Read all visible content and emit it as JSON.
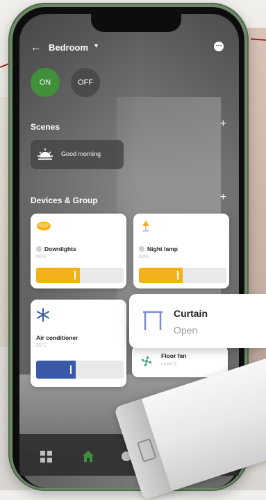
{
  "colors": {
    "accent_green": "#3f8f3b",
    "slider_yellow": "#f2b21a",
    "slider_blue": "#3a58a8",
    "card_bg": "#ffffff",
    "curtain_icon": "#7a8ccf",
    "fan_icon": "#4aa58a"
  },
  "header": {
    "room": "Bedroom",
    "back_icon": "arrow-left-icon",
    "more_icon": "more-icon"
  },
  "power": {
    "on_label": "ON",
    "off_label": "OFF"
  },
  "scenes": {
    "title": "Scenes",
    "items": [
      {
        "label": "Good morning",
        "icon": "sunrise-icon"
      }
    ]
  },
  "devices": {
    "title": "Devices & Group",
    "downlights": {
      "name": "Downlights",
      "level_text": "50%",
      "level": 0.5
    },
    "night_lamp": {
      "name": "Night lamp",
      "level_text": "50%",
      "level": 0.5
    },
    "air_conditioner": {
      "name": "Air conditioner",
      "temp": "25°C",
      "level": 0.45
    },
    "curtain": {
      "name": "Curtain",
      "state": "Open"
    },
    "floor_fan": {
      "name": "Floor fan",
      "level_text": "Level 2"
    }
  },
  "nav": {
    "items": [
      "grid-icon",
      "home-icon",
      "circle-icon"
    ]
  }
}
